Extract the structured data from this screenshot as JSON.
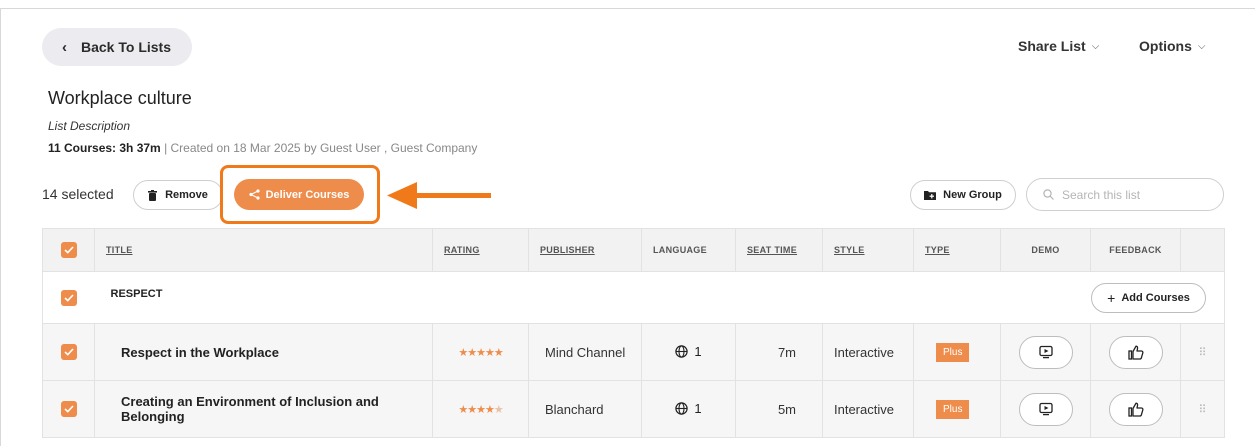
{
  "header": {
    "back_label": "Back To Lists",
    "share_label": "Share List",
    "options_label": "Options"
  },
  "list": {
    "title": "Workplace culture",
    "description": "List Description",
    "summary_bold": "11 Courses: 3h 37m",
    "summary_rest": " | Created on 18 Mar 2025 by Guest User , Guest Company"
  },
  "toolbar": {
    "selected_text": "14 selected",
    "remove_label": "Remove",
    "deliver_label": "Deliver Courses",
    "new_group_label": "New Group",
    "search_placeholder": "Search this list"
  },
  "table": {
    "columns": [
      "TITLE",
      "RATING",
      "PUBLISHER",
      "LANGUAGE",
      "SEAT TIME",
      "STYLE",
      "TYPE",
      "DEMO",
      "FEEDBACK"
    ],
    "group": {
      "name": "RESPECT",
      "add_label": "Add Courses"
    },
    "rows": [
      {
        "title": "Respect in the Workplace",
        "rating": 5,
        "publisher": "Mind Channel",
        "language_count": "1",
        "seat_time": "7m",
        "style": "Interactive",
        "type": "Plus"
      },
      {
        "title": "Creating an Environment of Inclusion and Belonging",
        "rating": 4.5,
        "publisher": "Blanchard",
        "language_count": "1",
        "seat_time": "5m",
        "style": "Interactive",
        "type": "Plus"
      }
    ]
  },
  "colors": {
    "accent": "#ee8c4b",
    "highlight": "#f07a1a"
  }
}
